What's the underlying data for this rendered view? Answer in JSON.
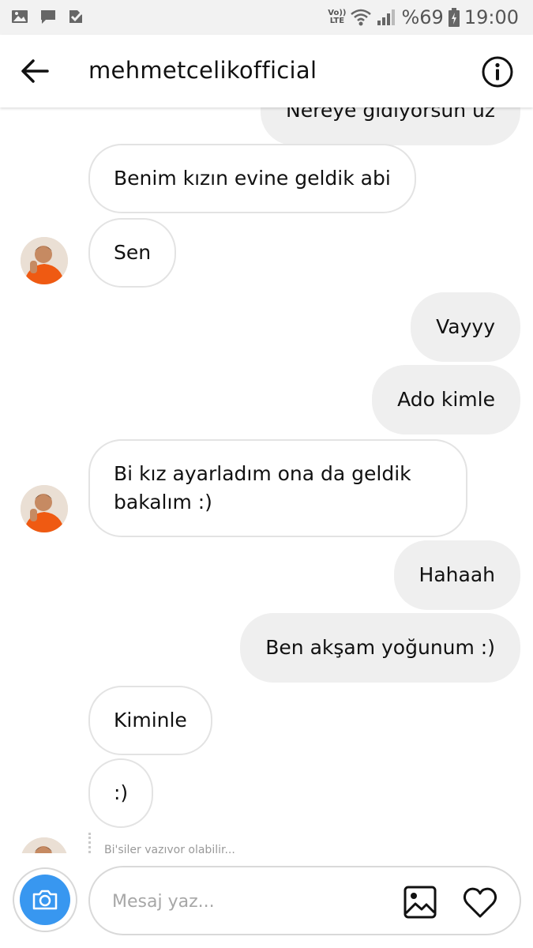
{
  "status_bar": {
    "left_icons": [
      "image-icon",
      "chat-icon",
      "check-icon"
    ],
    "network_top": "Vo))",
    "network_bottom": "LTE",
    "battery": "%69",
    "time": "19:00"
  },
  "header": {
    "back_icon": "arrow-left-icon",
    "title": "mehmetcelikofficial",
    "info_icon": "info-icon"
  },
  "messages": [
    {
      "side": "out",
      "text": "Nereye gidiyorsun üz"
    },
    {
      "side": "in",
      "text": "Benim kızın evine geldik abi"
    },
    {
      "side": "in",
      "text": "Sen"
    },
    {
      "side": "out",
      "text": "Vayyy"
    },
    {
      "side": "out",
      "text": "Ado kimle"
    },
    {
      "side": "in",
      "text": "Bi kız ayarladım ona da geldik",
      "text2": "bakalım :)"
    },
    {
      "side": "out",
      "text": "Hahaah"
    },
    {
      "side": "out",
      "text": "Ben akşam yoğunum :)"
    },
    {
      "side": "in",
      "text": "Kiminle"
    },
    {
      "side": "in",
      "text": ":)"
    }
  ],
  "seen_text": "Bi'şiler yazıyor olabilir...",
  "composer": {
    "placeholder": "Mesaj yaz...",
    "camera_icon": "camera-icon",
    "gallery_icon": "gallery-icon",
    "heart_icon": "heart-icon"
  },
  "colors": {
    "accent_blue": "#3897f0",
    "incoming_border": "#e3e3e3",
    "outgoing_bg": "#efefef",
    "status_bar_bg": "#f2f2f2"
  }
}
